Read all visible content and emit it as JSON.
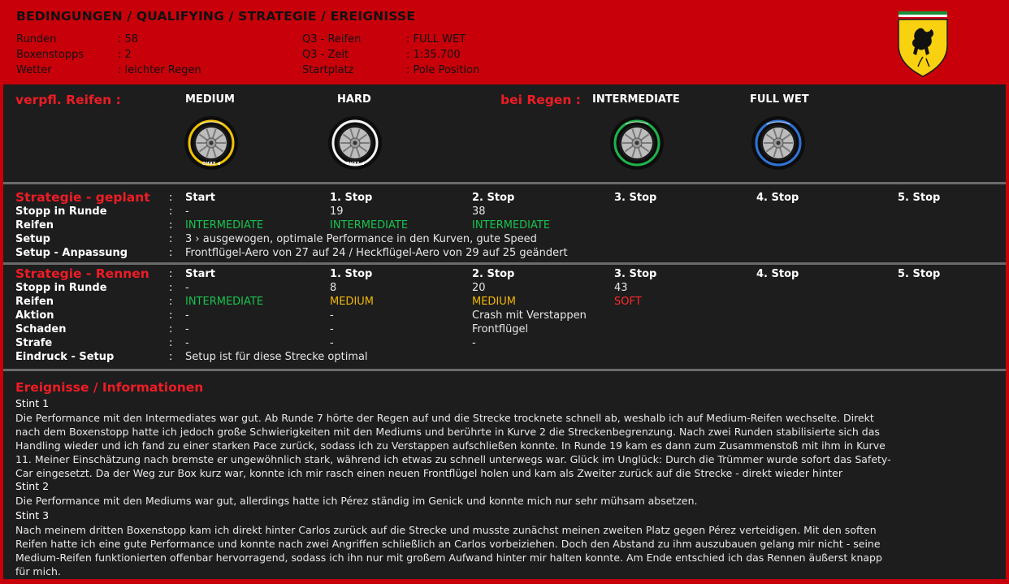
{
  "header": {
    "title": "BEDINGUNGEN / QUALIFYING / STRATEGIE  /  EREIGNISSE",
    "left": [
      {
        "label": "Runden",
        "value": ": 58"
      },
      {
        "label": "Boxenstopps",
        "value": ": 2"
      },
      {
        "label": "Wetter",
        "value": ": leichter Regen"
      }
    ],
    "right": [
      {
        "label": "Q3 - Reifen",
        "value": ": FULL WET"
      },
      {
        "label": "Q3 - Zeit",
        "value": ": 1:35.700"
      },
      {
        "label": "Startplatz",
        "value": ": Pole Position"
      }
    ]
  },
  "tyres": {
    "mandatory_title": "verpfl. Reifen :",
    "rain_title": "bei Regen :",
    "items": [
      {
        "name": "MEDIUM",
        "band_color": "#f2c200",
        "wall_text": "P ZERO"
      },
      {
        "name": "HARD",
        "band_color": "#f4f4f4",
        "wall_text": "P ZERO"
      },
      {
        "name": "INTERMEDIATE",
        "band_color": "#1fb34a",
        "wall_text": ""
      },
      {
        "name": "FULL WET",
        "band_color": "#2f74d8",
        "wall_text": ""
      }
    ]
  },
  "planned": {
    "title": "Strategie - geplant",
    "colon": ":",
    "columns": [
      "Start",
      "1. Stop",
      "2. Stop",
      "3. Stop",
      "4. Stop",
      "5. Stop"
    ],
    "rows": [
      {
        "label": "Stopp in Runde",
        "cells": [
          "-",
          "19",
          "38"
        ]
      },
      {
        "label": "Reifen",
        "cells": [
          "INTERMEDIATE",
          "INTERMEDIATE",
          "INTERMEDIATE"
        ]
      },
      {
        "label": "Setup",
        "full": "3  ›  ausgewogen, optimale Performance in den Kurven, gute Speed"
      },
      {
        "label": "Setup - Anpassung",
        "full": "Frontflügel-Aero von 27 auf 24 / Heckflügel-Aero von 29 auf 25 geändert"
      }
    ]
  },
  "race": {
    "title": "Strategie - Rennen",
    "colon": ":",
    "columns": [
      "Start",
      "1. Stop",
      "2. Stop",
      "3. Stop",
      "4. Stop",
      "5. Stop"
    ],
    "rows": [
      {
        "label": "Stopp in Runde",
        "cells": [
          "-",
          "8",
          "20",
          "43"
        ]
      },
      {
        "label": "Reifen",
        "cells": [
          "INTERMEDIATE",
          "MEDIUM",
          "MEDIUM",
          "SOFT"
        ]
      },
      {
        "label": "Aktion",
        "cells": [
          "-",
          "-",
          "Crash mit Verstappen"
        ]
      },
      {
        "label": "Schaden",
        "cells": [
          "-",
          "-",
          "Frontflügel"
        ]
      },
      {
        "label": "Strafe",
        "cells": [
          "-",
          "-",
          "-"
        ]
      },
      {
        "label": "Eindruck - Setup",
        "full": "Setup ist für diese Strecke optimal"
      }
    ]
  },
  "events": {
    "title": "Ereignisse / Informationen",
    "stints": [
      {
        "title": "Stint 1",
        "lines": [
          "Die Performance mit den Intermediates war gut. Ab Runde 7 hörte der Regen auf und die Strecke trocknete schnell ab, weshalb ich auf Medium-Reifen wechselte. Direkt",
          "nach dem Boxenstopp hatte ich jedoch große Schwierigkeiten mit den Mediums und berührte in Kurve 2 die Streckenbegrenzung. Nach zwei Runden stabilisierte sich das",
          "Handling wieder und ich fand zu einer starken Pace zurück, sodass ich zu Verstappen aufschließen konnte. In Runde 19 kam es dann zum Zusammenstoß mit ihm in Kurve",
          "11. Meiner Einschätzung nach bremste er ungewöhnlich stark, während ich etwas zu schnell unterwegs war. Glück im Unglück: Durch die Trümmer wurde sofort das Safety-",
          "Car eingesetzt. Da der Weg zur Box kurz war, konnte ich mir rasch einen neuen Frontflügel holen und kam als Zweiter zurück auf die Strecke - direkt wieder hinter"
        ]
      },
      {
        "title": "Stint 2",
        "lines": [
          "Die Performance mit den Mediums war gut, allerdings hatte ich Pérez ständig im Genick und konnte mich nur sehr mühsam absetzen."
        ]
      },
      {
        "title": "Stint 3",
        "lines": [
          "Nach meinem dritten Boxenstopp kam ich direkt hinter Carlos zurück auf die Strecke und musste zunächst meinen zweiten Platz gegen Pérez verteidigen. Mit den soften",
          "Reifen hatte ich eine gute Performance und konnte nach zwei Angriffen schließlich an Carlos vorbeiziehen. Doch den Abstand zu ihm auszubauen gelang mir nicht - seine",
          "Medium-Reifen funktionierten offenbar hervorragend, sodass ich ihn nur mit großem Aufwand hinter mir halten konnte. Am Ende entschied ich das Rennen äußerst knapp",
          "für mich."
        ]
      }
    ]
  },
  "colors": {
    "accent_red": "#ee1c25",
    "background_red": "#c8000a",
    "panel": "#1d1d1d",
    "intermediate": "#19c24f",
    "medium": "#f2b705",
    "soft": "#ff2a2a"
  }
}
